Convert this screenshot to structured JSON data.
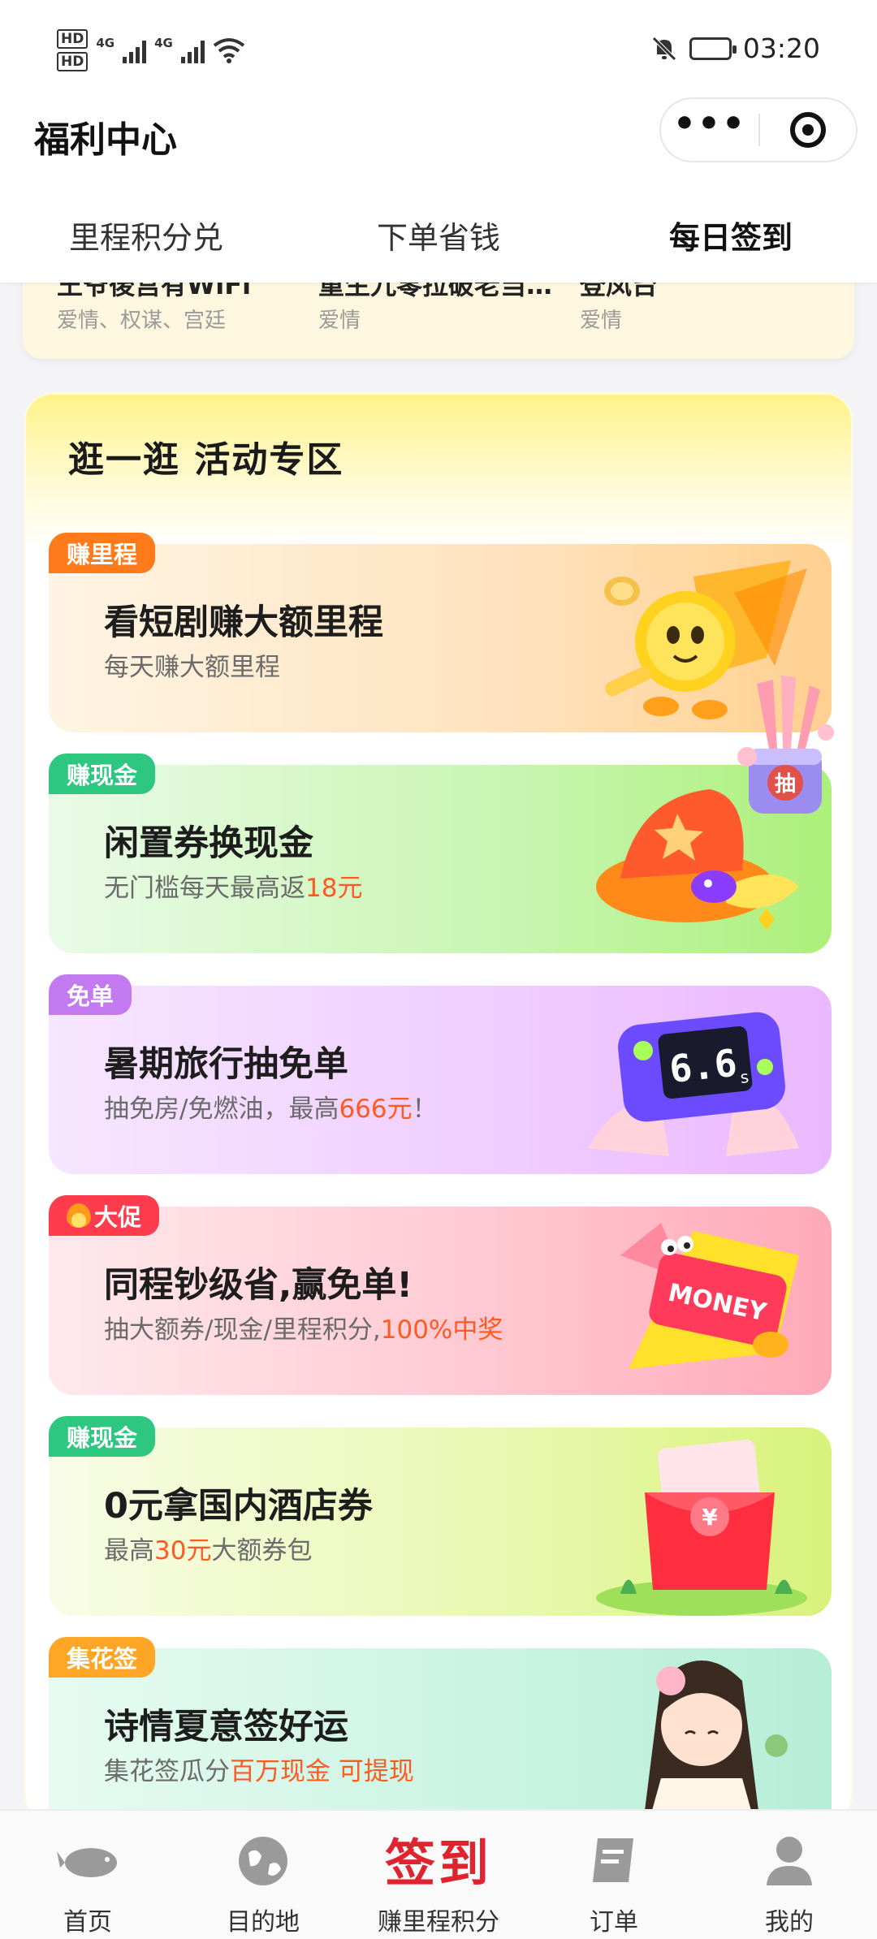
{
  "status_bar": {
    "hd1": "HD",
    "hd2": "HD",
    "net1": "4G",
    "net2": "4G",
    "time": "03:20"
  },
  "header": {
    "title": "福利中心",
    "more_label": "•••"
  },
  "tabs": [
    {
      "label": "里程积分兑",
      "active": false
    },
    {
      "label": "下单省钱",
      "active": false
    },
    {
      "label": "每日签到",
      "active": true
    }
  ],
  "partial_card": {
    "items": [
      {
        "title": "王爷後宫有WiFi",
        "tags": "爱情、权谋、宫廷"
      },
      {
        "title": "重生九零拉破老当…",
        "tags": "爱情"
      },
      {
        "title": "登凤台",
        "tags": "爱情"
      }
    ]
  },
  "activity": {
    "title": "逛一逛 活动专区",
    "cards": [
      {
        "badge": "赚里程",
        "title": "看短剧赚大额里程",
        "sub_pre": "每天赚大额里程",
        "sub_hl": "",
        "sub_post": ""
      },
      {
        "badge": "赚现金",
        "title": "闲置券换现金",
        "sub_pre": "无门槛每天最高返",
        "sub_hl": "18元",
        "sub_post": ""
      },
      {
        "badge": "免单",
        "title": "暑期旅行抽免单",
        "sub_pre": "抽免房/免燃油，最高",
        "sub_hl": "666元",
        "sub_post": "！"
      },
      {
        "badge": "大促",
        "title": "同程钞级省,赢免单!",
        "sub_pre": "抽大额券/现金/里程积分,",
        "sub_hl": "100%中奖",
        "sub_post": ""
      },
      {
        "badge": "赚现金",
        "title": "0元拿国内酒店券",
        "sub_pre": "最高",
        "sub_hl": "30元",
        "sub_post": "大额券包"
      },
      {
        "badge": "集花签",
        "title": "诗情夏意签好运",
        "sub_pre": "集花签瓜分",
        "sub_hl": "百万现金 可提现",
        "sub_post": ""
      }
    ],
    "illustration_texts": {
      "game_screen": "6.6",
      "game_unit": "s",
      "money": "MONEY",
      "yen": "¥",
      "draw": "抽"
    }
  },
  "bottom_nav": [
    {
      "label": "首页",
      "icon": "whale-icon"
    },
    {
      "label": "目的地",
      "icon": "globe-icon"
    },
    {
      "label": "赚里程积分",
      "icon": "sign-in-icon",
      "sign_text": "签到"
    },
    {
      "label": "订单",
      "icon": "order-book-icon"
    },
    {
      "label": "我的",
      "icon": "user-icon"
    }
  ],
  "colors": {
    "accent_orange": "#ff5a1f",
    "sign_red": "#e0242f"
  }
}
